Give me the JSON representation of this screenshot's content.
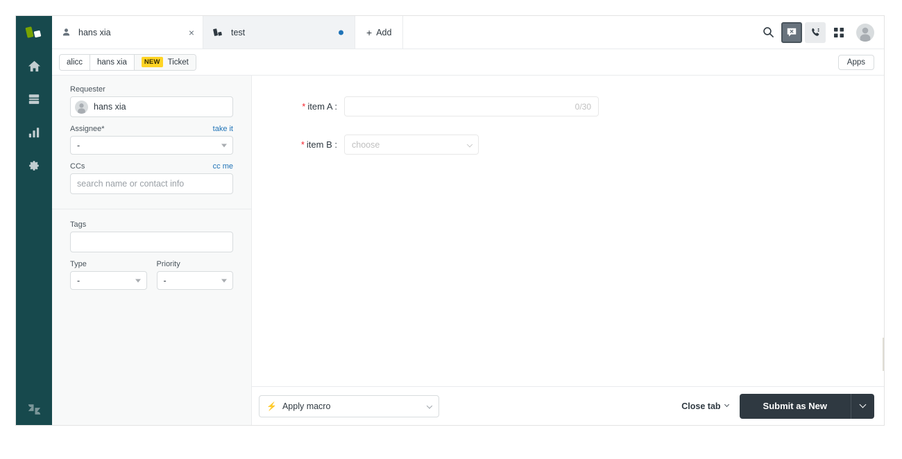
{
  "brand": {
    "logo_name": "zendesk-logo",
    "footer_logo_name": "zendesk-z-logo",
    "nav_bg": "#17494d",
    "accent_blue": "#1f73b7",
    "badge_yellow": "#ffd424",
    "submit_dark": "#2f3941",
    "required_red": "#f5222d"
  },
  "nav": {
    "items": [
      {
        "name": "home-icon",
        "label": "Home"
      },
      {
        "name": "views-icon",
        "label": "Views"
      },
      {
        "name": "reporting-icon",
        "label": "Reporting"
      },
      {
        "name": "admin-gear-icon",
        "label": "Admin"
      }
    ]
  },
  "tabs": [
    {
      "label": "hans xia",
      "icon": "user-icon",
      "active": true,
      "closable": true,
      "close_glyph": "×"
    },
    {
      "label": "test",
      "icon": "ticket-icon",
      "active": false,
      "unsaved": true
    }
  ],
  "tabbar": {
    "add_label": "Add",
    "add_glyph": "+",
    "actions": [
      {
        "name": "search-icon",
        "label": "Search"
      },
      {
        "name": "chat-offline-icon",
        "label": "Chat"
      },
      {
        "name": "talk-phone-icon",
        "label": "Talk"
      },
      {
        "name": "products-grid-icon",
        "label": "Products"
      },
      {
        "name": "user-avatar",
        "label": "Profile"
      }
    ]
  },
  "breadcrumb": {
    "items": [
      "alicc",
      "hans xia"
    ],
    "current_badge": "NEW",
    "current_label": "Ticket"
  },
  "apps": {
    "label": "Apps"
  },
  "properties": {
    "requester": {
      "label": "Requester",
      "value": "hans xia",
      "avatar_name": "requester-avatar"
    },
    "assignee": {
      "label": "Assignee*",
      "action_label": "take it",
      "value": "-"
    },
    "ccs": {
      "label": "CCs",
      "action_label": "cc me",
      "placeholder": "search name or contact info",
      "value": ""
    },
    "tags": {
      "label": "Tags",
      "value": ""
    },
    "type": {
      "label": "Type",
      "value": "-"
    },
    "priority": {
      "label": "Priority",
      "value": "-"
    }
  },
  "ticket_form": {
    "fields": [
      {
        "label": "item A :",
        "required": true,
        "kind": "text",
        "value": "",
        "counter": "0/30"
      },
      {
        "label": "item B :",
        "required": true,
        "kind": "select",
        "value": "",
        "placeholder": "choose"
      }
    ]
  },
  "footer": {
    "macro_label": "Apply macro",
    "macro_icon": "bolt-icon",
    "close_tab_label": "Close tab",
    "submit_label": "Submit as New",
    "submit_caret_name": "submit-options-caret"
  }
}
